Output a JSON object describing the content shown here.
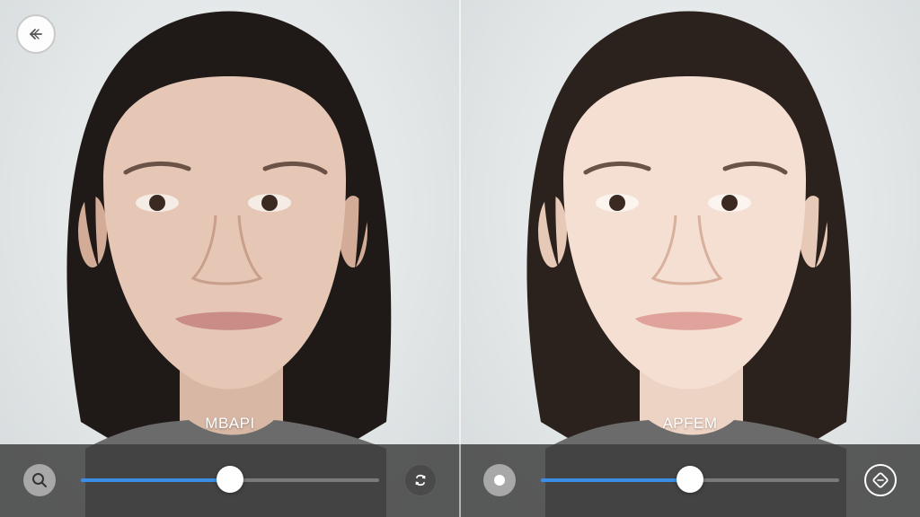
{
  "header": {
    "back_icon": "back-arrow-icon"
  },
  "panels": [
    {
      "label": "MBAPI",
      "slider": {
        "value": 0.5
      },
      "left_icon": "search-icon",
      "right_icon": "swap-icon"
    },
    {
      "label": "APFEM",
      "slider": {
        "value": 0.5
      },
      "left_icon": "record-dot-icon",
      "right_icon": "compare-icon"
    }
  ],
  "colors": {
    "accent": "#3a8ee6",
    "bar": "#3a3a3a"
  }
}
